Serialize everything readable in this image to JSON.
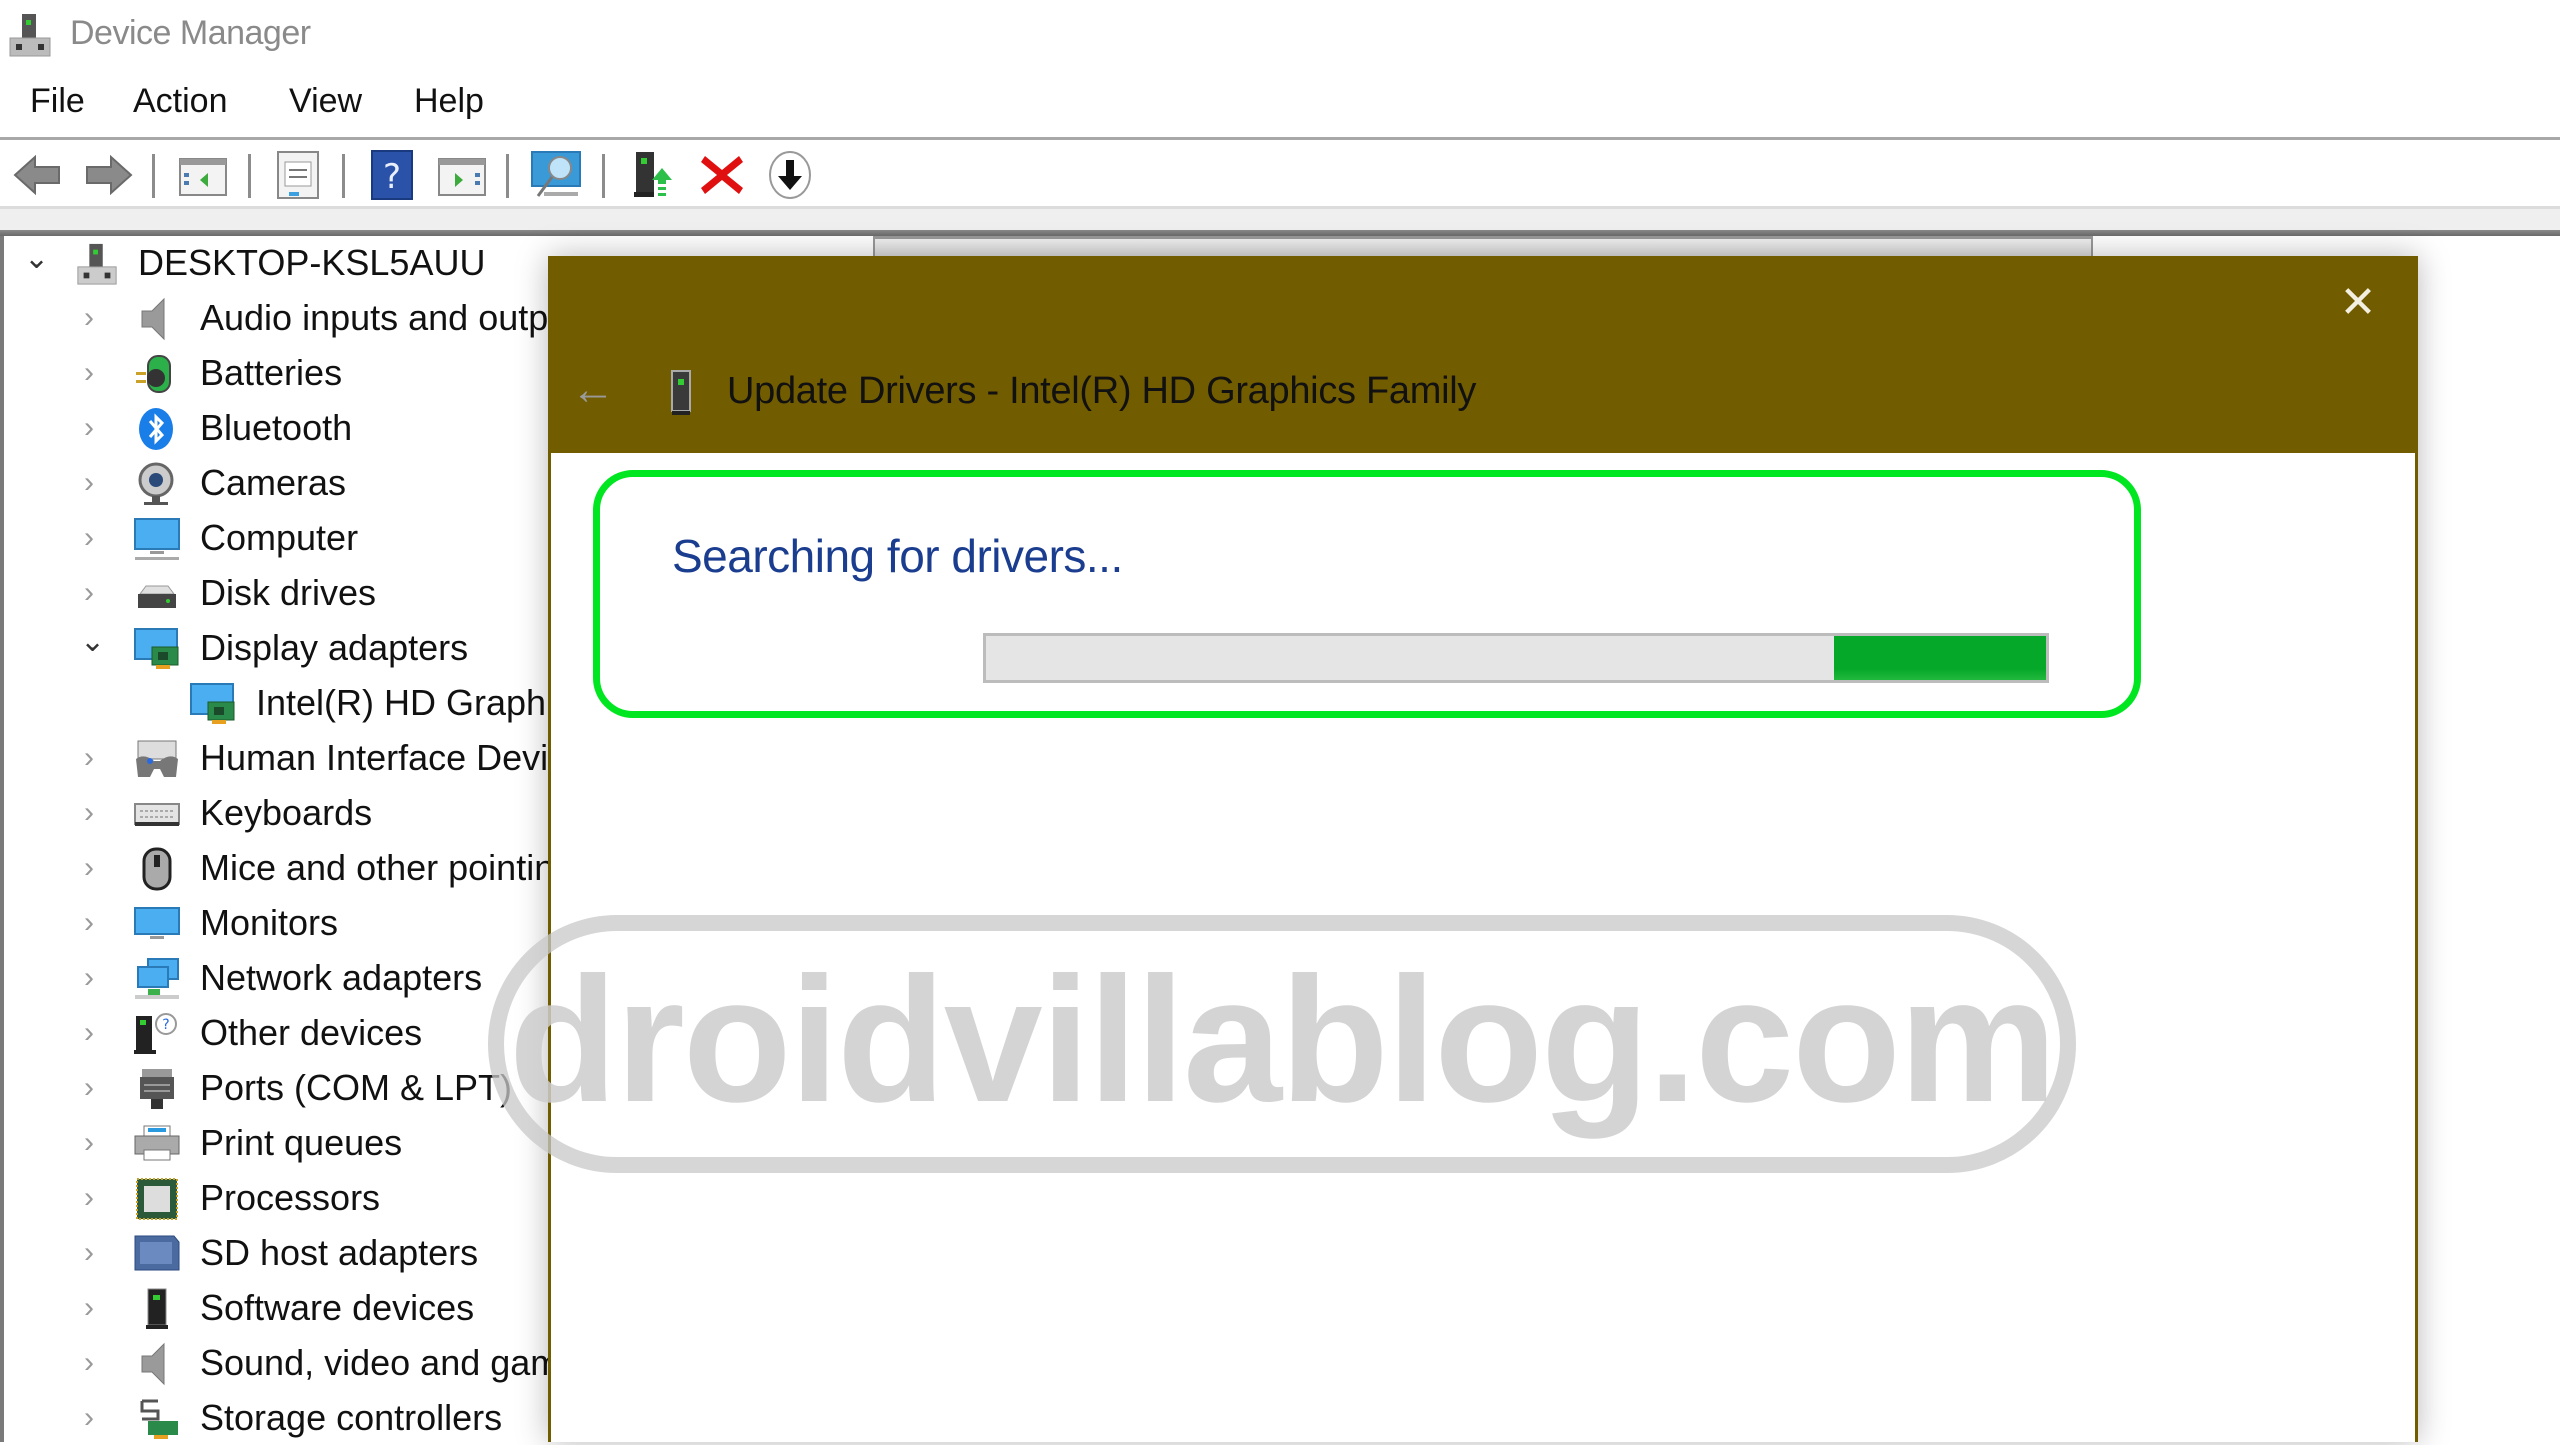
{
  "window": {
    "title": "Device Manager",
    "app_icon": "computer-tower-icon"
  },
  "menu": {
    "items": [
      {
        "label": "File"
      },
      {
        "label": "Action"
      },
      {
        "label": "View"
      },
      {
        "label": "Help"
      }
    ]
  },
  "toolbar": {
    "buttons": [
      {
        "name": "back",
        "icon": "arrow-left-icon"
      },
      {
        "name": "forward",
        "icon": "arrow-right-icon"
      },
      {
        "name": "show-hide-console-tree",
        "icon": "console-tree-icon"
      },
      {
        "name": "properties",
        "icon": "properties-icon"
      },
      {
        "name": "help",
        "icon": "help-icon"
      },
      {
        "name": "show-hide-action-pane",
        "icon": "action-pane-icon"
      },
      {
        "name": "scan-hardware-changes",
        "icon": "monitor-scan-icon"
      },
      {
        "name": "update-driver",
        "icon": "update-driver-icon"
      },
      {
        "name": "uninstall-device",
        "icon": "uninstall-x-icon"
      },
      {
        "name": "download",
        "icon": "download-circle-icon"
      }
    ]
  },
  "tree": {
    "root": {
      "label": "DESKTOP-KSL5AUU",
      "expanded": true
    },
    "items": [
      {
        "label": "Audio inputs and outputs",
        "icon": "speaker-icon",
        "expanded": false
      },
      {
        "label": "Batteries",
        "icon": "battery-icon",
        "expanded": false
      },
      {
        "label": "Bluetooth",
        "icon": "bluetooth-icon",
        "expanded": false
      },
      {
        "label": "Cameras",
        "icon": "camera-icon",
        "expanded": false
      },
      {
        "label": "Computer",
        "icon": "monitor-icon",
        "expanded": false
      },
      {
        "label": "Disk drives",
        "icon": "disk-drive-icon",
        "expanded": false
      },
      {
        "label": "Display adapters",
        "icon": "display-adapter-icon",
        "expanded": true
      },
      {
        "label": "Intel(R) HD Graphics Family",
        "icon": "display-adapter-icon",
        "child": true
      },
      {
        "label": "Human Interface Devices",
        "icon": "hid-icon",
        "expanded": false
      },
      {
        "label": "Keyboards",
        "icon": "keyboard-icon",
        "expanded": false
      },
      {
        "label": "Mice and other pointing devices",
        "icon": "mouse-icon",
        "expanded": false
      },
      {
        "label": "Monitors",
        "icon": "monitor-icon",
        "expanded": false
      },
      {
        "label": "Network adapters",
        "icon": "network-icon",
        "expanded": false
      },
      {
        "label": "Other devices",
        "icon": "unknown-device-icon",
        "expanded": false
      },
      {
        "label": "Ports (COM & LPT)",
        "icon": "port-icon",
        "expanded": false
      },
      {
        "label": "Print queues",
        "icon": "printer-icon",
        "expanded": false
      },
      {
        "label": "Processors",
        "icon": "processor-icon",
        "expanded": false
      },
      {
        "label": "SD host adapters",
        "icon": "sd-card-icon",
        "expanded": false
      },
      {
        "label": "Software devices",
        "icon": "software-device-icon",
        "expanded": false
      },
      {
        "label": "Sound, video and game controllers",
        "icon": "speaker-icon",
        "expanded": false
      },
      {
        "label": "Storage controllers",
        "icon": "storage-controller-icon",
        "expanded": false
      }
    ]
  },
  "dialog": {
    "title": "Update Drivers - Intel(R) HD Graphics Family",
    "status": "Searching for drivers...",
    "progress_marquee_start": 0.8,
    "progress_marquee_end": 1.0,
    "header_color": "#725C00",
    "highlight_color": "#00E620",
    "progress_color": "#06A82A"
  },
  "watermark": {
    "text": "droidvillablog.com"
  }
}
